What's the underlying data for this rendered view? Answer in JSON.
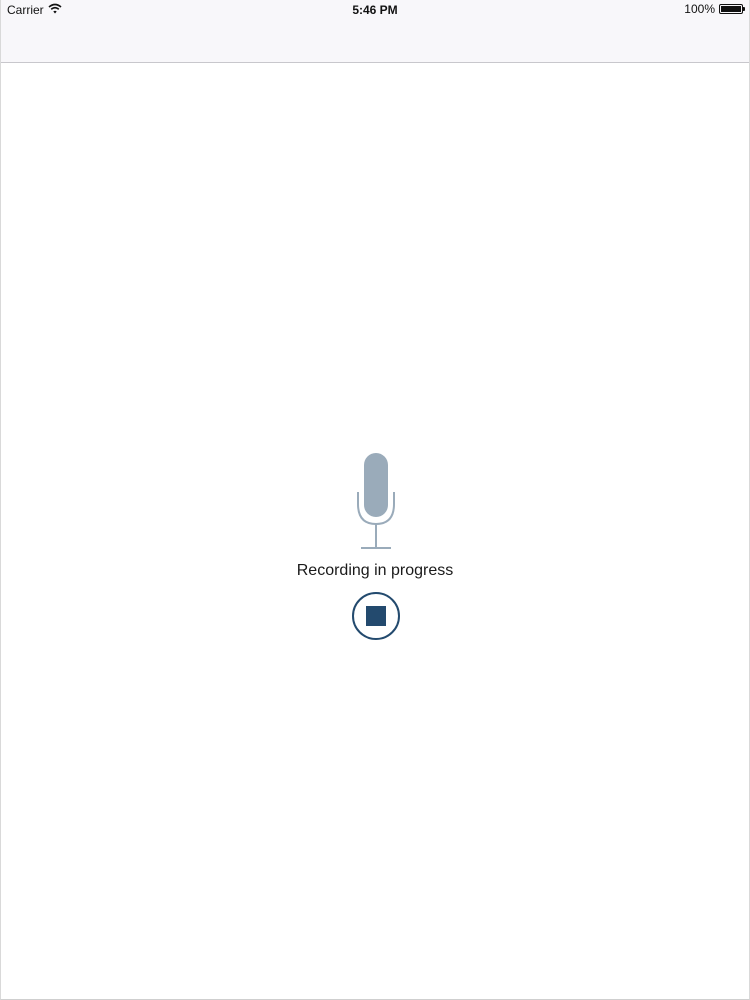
{
  "status_bar": {
    "carrier": "Carrier",
    "time": "5:46 PM",
    "battery_text": "100%",
    "battery_level": 1.0,
    "icons": [
      "wifi-icon",
      "battery-icon"
    ]
  },
  "recorder": {
    "status_text": "Recording in progress",
    "mic_icon": "microphone-icon",
    "stop_icon": "stop-icon"
  },
  "colors": {
    "mic": "#9aabba",
    "stop": "#234a6e",
    "status_bg": "#f8f7fa",
    "nav_border": "#c8c7cc"
  }
}
